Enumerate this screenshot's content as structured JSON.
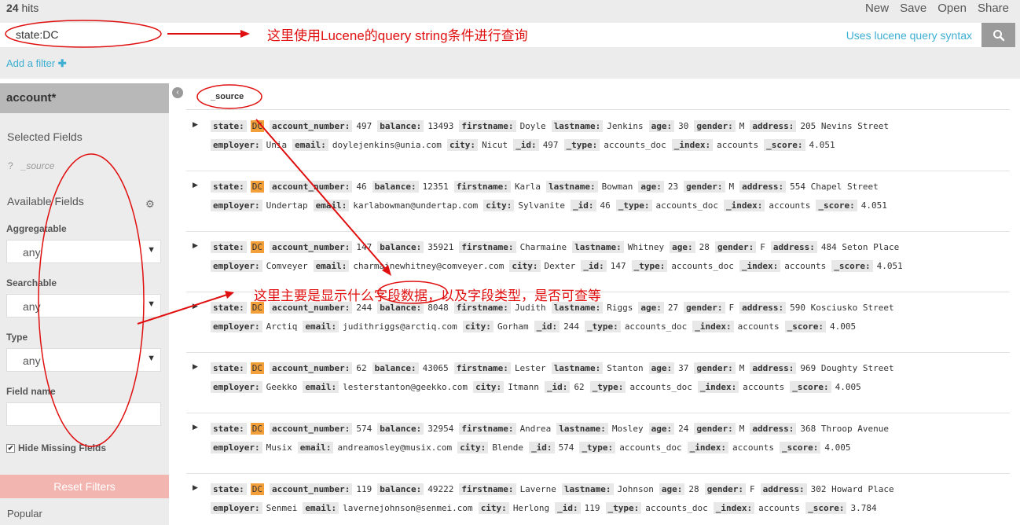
{
  "header": {
    "hits_count": "24",
    "hits_label": "hits",
    "menu": [
      "New",
      "Save",
      "Open",
      "Share"
    ]
  },
  "search": {
    "query": "state:DC",
    "hint": "Uses lucene query syntax",
    "button_icon": "search-icon"
  },
  "filter": {
    "add_label": "Add a filter",
    "add_icon": "plus-icon"
  },
  "sidebar": {
    "index_pattern": "account*",
    "selected_title": "Selected Fields",
    "selected_field": "_source",
    "selected_field_type": "?",
    "available_title": "Available Fields",
    "aggregatable_label": "Aggregatable",
    "aggregatable_value": "any",
    "searchable_label": "Searchable",
    "searchable_value": "any",
    "type_label": "Type",
    "type_value": "any",
    "fieldname_label": "Field name",
    "fieldname_value": "",
    "hide_missing_label": "Hide Missing Fields",
    "hide_missing_checked": true,
    "reset_label": "Reset Filters",
    "popular_title": "Popular"
  },
  "table": {
    "source_header": "_source"
  },
  "annotations": {
    "query_note": "这里使用Lucene的query string条件进行查询",
    "fields_note": "这里主要是显示什么字段数据，以及字段类型，是否可查等",
    "color": "#e01010"
  },
  "docs": [
    {
      "line1": [
        {
          "k": "state:",
          "v": "DC",
          "hl": true
        },
        {
          "k": "account_number:",
          "v": "497"
        },
        {
          "k": "balance:",
          "v": "13493"
        },
        {
          "k": "firstname:",
          "v": "Doyle"
        },
        {
          "k": "lastname:",
          "v": "Jenkins"
        },
        {
          "k": "age:",
          "v": "30"
        },
        {
          "k": "gender:",
          "v": "M"
        },
        {
          "k": "address:",
          "v": "205 Nevins Street"
        }
      ],
      "line2": [
        {
          "k": "employer:",
          "v": "Unia"
        },
        {
          "k": "email:",
          "v": "doylejenkins@unia.com"
        },
        {
          "k": "city:",
          "v": "Nicut"
        },
        {
          "k": "_id:",
          "v": "497"
        },
        {
          "k": "_type:",
          "v": "accounts_doc"
        },
        {
          "k": "_index:",
          "v": "accounts"
        },
        {
          "k": "_score:",
          "v": "4.051"
        }
      ]
    },
    {
      "line1": [
        {
          "k": "state:",
          "v": "DC",
          "hl": true
        },
        {
          "k": "account_number:",
          "v": "46"
        },
        {
          "k": "balance:",
          "v": "12351"
        },
        {
          "k": "firstname:",
          "v": "Karla"
        },
        {
          "k": "lastname:",
          "v": "Bowman"
        },
        {
          "k": "age:",
          "v": "23"
        },
        {
          "k": "gender:",
          "v": "M"
        },
        {
          "k": "address:",
          "v": "554 Chapel Street"
        }
      ],
      "line2": [
        {
          "k": "employer:",
          "v": "Undertap"
        },
        {
          "k": "email:",
          "v": "karlabowman@undertap.com"
        },
        {
          "k": "city:",
          "v": "Sylvanite"
        },
        {
          "k": "_id:",
          "v": "46"
        },
        {
          "k": "_type:",
          "v": "accounts_doc"
        },
        {
          "k": "_index:",
          "v": "accounts"
        },
        {
          "k": "_score:",
          "v": "4.051"
        }
      ]
    },
    {
      "line1": [
        {
          "k": "state:",
          "v": "DC",
          "hl": true
        },
        {
          "k": "account_number:",
          "v": "147"
        },
        {
          "k": "balance:",
          "v": "35921"
        },
        {
          "k": "firstname:",
          "v": "Charmaine"
        },
        {
          "k": "lastname:",
          "v": "Whitney"
        },
        {
          "k": "age:",
          "v": "28"
        },
        {
          "k": "gender:",
          "v": "F"
        },
        {
          "k": "address:",
          "v": "484 Seton Place"
        }
      ],
      "line2": [
        {
          "k": "employer:",
          "v": "Comveyer"
        },
        {
          "k": "email:",
          "v": "charmainewhitney@comveyer.com"
        },
        {
          "k": "city:",
          "v": "Dexter"
        },
        {
          "k": "_id:",
          "v": "147"
        },
        {
          "k": "_type:",
          "v": "accounts_doc"
        },
        {
          "k": "_index:",
          "v": "accounts"
        },
        {
          "k": "_score:",
          "v": "4.051"
        }
      ]
    },
    {
      "line1": [
        {
          "k": "state:",
          "v": "DC",
          "hl": true
        },
        {
          "k": "account_number:",
          "v": "244"
        },
        {
          "k": "balance:",
          "v": "8048"
        },
        {
          "k": "firstname:",
          "v": "Judith"
        },
        {
          "k": "lastname:",
          "v": "Riggs"
        },
        {
          "k": "age:",
          "v": "27"
        },
        {
          "k": "gender:",
          "v": "F"
        },
        {
          "k": "address:",
          "v": "590 Kosciusko Street"
        }
      ],
      "line2": [
        {
          "k": "employer:",
          "v": "Arctiq"
        },
        {
          "k": "email:",
          "v": "judithriggs@arctiq.com"
        },
        {
          "k": "city:",
          "v": "Gorham"
        },
        {
          "k": "_id:",
          "v": "244"
        },
        {
          "k": "_type:",
          "v": "accounts_doc"
        },
        {
          "k": "_index:",
          "v": "accounts"
        },
        {
          "k": "_score:",
          "v": "4.005"
        }
      ]
    },
    {
      "line1": [
        {
          "k": "state:",
          "v": "DC",
          "hl": true
        },
        {
          "k": "account_number:",
          "v": "62"
        },
        {
          "k": "balance:",
          "v": "43065"
        },
        {
          "k": "firstname:",
          "v": "Lester"
        },
        {
          "k": "lastname:",
          "v": "Stanton"
        },
        {
          "k": "age:",
          "v": "37"
        },
        {
          "k": "gender:",
          "v": "M"
        },
        {
          "k": "address:",
          "v": "969 Doughty Street"
        }
      ],
      "line2": [
        {
          "k": "employer:",
          "v": "Geekko"
        },
        {
          "k": "email:",
          "v": "lesterstanton@geekko.com"
        },
        {
          "k": "city:",
          "v": "Itmann"
        },
        {
          "k": "_id:",
          "v": "62"
        },
        {
          "k": "_type:",
          "v": "accounts_doc"
        },
        {
          "k": "_index:",
          "v": "accounts"
        },
        {
          "k": "_score:",
          "v": "4.005"
        }
      ]
    },
    {
      "line1": [
        {
          "k": "state:",
          "v": "DC",
          "hl": true
        },
        {
          "k": "account_number:",
          "v": "574"
        },
        {
          "k": "balance:",
          "v": "32954"
        },
        {
          "k": "firstname:",
          "v": "Andrea"
        },
        {
          "k": "lastname:",
          "v": "Mosley"
        },
        {
          "k": "age:",
          "v": "24"
        },
        {
          "k": "gender:",
          "v": "M"
        },
        {
          "k": "address:",
          "v": "368 Throop Avenue"
        }
      ],
      "line2": [
        {
          "k": "employer:",
          "v": "Musix"
        },
        {
          "k": "email:",
          "v": "andreamosley@musix.com"
        },
        {
          "k": "city:",
          "v": "Blende"
        },
        {
          "k": "_id:",
          "v": "574"
        },
        {
          "k": "_type:",
          "v": "accounts_doc"
        },
        {
          "k": "_index:",
          "v": "accounts"
        },
        {
          "k": "_score:",
          "v": "4.005"
        }
      ]
    },
    {
      "line1": [
        {
          "k": "state:",
          "v": "DC",
          "hl": true
        },
        {
          "k": "account_number:",
          "v": "119"
        },
        {
          "k": "balance:",
          "v": "49222"
        },
        {
          "k": "firstname:",
          "v": "Laverne"
        },
        {
          "k": "lastname:",
          "v": "Johnson"
        },
        {
          "k": "age:",
          "v": "28"
        },
        {
          "k": "gender:",
          "v": "F"
        },
        {
          "k": "address:",
          "v": "302 Howard Place"
        }
      ],
      "line2": [
        {
          "k": "employer:",
          "v": "Senmei"
        },
        {
          "k": "email:",
          "v": "lavernejohnson@senmei.com"
        },
        {
          "k": "city:",
          "v": "Herlong"
        },
        {
          "k": "_id:",
          "v": "119"
        },
        {
          "k": "_type:",
          "v": "accounts_doc"
        },
        {
          "k": "_index:",
          "v": "accounts"
        },
        {
          "k": "_score:",
          "v": "3.784"
        }
      ]
    }
  ]
}
